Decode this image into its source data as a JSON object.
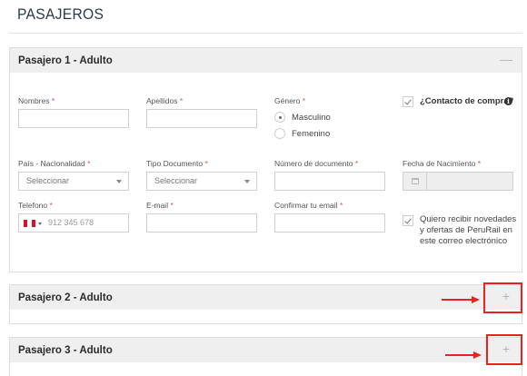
{
  "page_title": "PASAJEROS",
  "colors": {
    "required": "#d9534f",
    "annotation": "#e8231f",
    "panel_header": "#efefef"
  },
  "passengers": [
    {
      "title": "Pasajero 1 - Adulto",
      "toggle": "—",
      "expanded": true,
      "fields": {
        "nombres": {
          "label": "Nombres",
          "required": "*",
          "value": ""
        },
        "apellidos": {
          "label": "Apellidos",
          "required": "*",
          "value": ""
        },
        "genero": {
          "label": "Género",
          "required": "*",
          "options": [
            "Masculino",
            "Femenino"
          ],
          "selected": "Masculino"
        },
        "contacto": {
          "label": "¿Contacto de compra?",
          "checked": true,
          "icon": "info-icon"
        },
        "pais": {
          "label": "País - Nacionalidad",
          "required": "*",
          "placeholder": "Seleccionar"
        },
        "tipo_doc": {
          "label": "Tipo Documento",
          "required": "*",
          "placeholder": "Seleccionar"
        },
        "num_doc": {
          "label": "Número de documento",
          "required": "*",
          "value": ""
        },
        "fecha_nac": {
          "label": "Fecha de Nacimiento",
          "required": "*",
          "value": "",
          "icon": "calendar-icon"
        },
        "telefono": {
          "label": "Telefono",
          "required": "*",
          "placeholder": "912 345 678",
          "flag": "peru-flag-icon"
        },
        "email": {
          "label": "E-mail",
          "required": "*",
          "value": ""
        },
        "confirm_email": {
          "label": "Confirmar tu email",
          "required": "*",
          "value": ""
        },
        "newsletter": {
          "text": "Quiero recibir novedades y ofertas de PeruRail en este correo electrónico",
          "checked": true
        }
      }
    },
    {
      "title": "Pasajero 2 - Adulto",
      "toggle": "+",
      "expanded": false
    },
    {
      "title": "Pasajero 3 - Adulto",
      "toggle": "+",
      "expanded": false
    }
  ]
}
